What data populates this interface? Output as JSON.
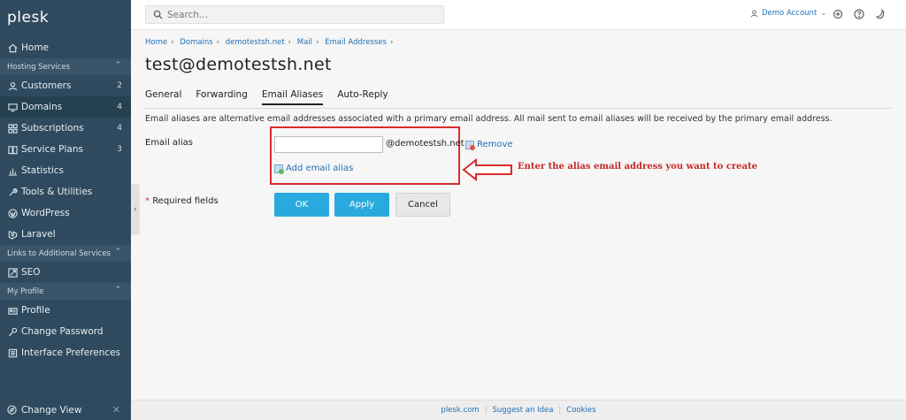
{
  "sidebar": {
    "logo": "plesk",
    "home": "Home",
    "sections": {
      "hosting": "Hosting Services",
      "links": "Links to Additional Services",
      "profile": "My Profile"
    },
    "hosting_items": [
      {
        "label": "Customers",
        "count": "2"
      },
      {
        "label": "Domains",
        "count": "4"
      },
      {
        "label": "Subscriptions",
        "count": "4"
      },
      {
        "label": "Service Plans",
        "count": "3"
      },
      {
        "label": "Statistics",
        "count": ""
      },
      {
        "label": "Tools & Utilities",
        "count": ""
      },
      {
        "label": "WordPress",
        "count": ""
      },
      {
        "label": "Laravel",
        "count": ""
      }
    ],
    "links_items": [
      {
        "label": "SEO"
      }
    ],
    "profile_items": [
      {
        "label": "Profile"
      },
      {
        "label": "Change Password"
      },
      {
        "label": "Interface Preferences"
      }
    ],
    "change_view": "Change View"
  },
  "topbar": {
    "search_placeholder": "Search...",
    "account": "Demo Account"
  },
  "breadcrumb": [
    "Home",
    "Domains",
    "demotestsh.net",
    "Mail",
    "Email Addresses"
  ],
  "page_title": "test@demotestsh.net",
  "tabs": [
    "General",
    "Forwarding",
    "Email Aliases",
    "Auto-Reply"
  ],
  "description": "Email aliases are alternative email addresses associated with a primary email address. All mail sent to email aliases will be received by the primary email address.",
  "form": {
    "field_label": "Email alias",
    "alias_value": "",
    "domain_suffix": "@demotestsh.net",
    "remove_label": "Remove",
    "add_label": "Add email alias",
    "required_text": "Required fields",
    "ok_label": "OK",
    "apply_label": "Apply",
    "cancel_label": "Cancel"
  },
  "annotation": "Enter the alias email address you want to create",
  "footer": [
    "plesk.com",
    "Suggest an Idea",
    "Cookies"
  ],
  "colors": {
    "sidebar_bg": "#2f4a5e",
    "accent": "#28aade",
    "link": "#1f6fb5",
    "highlight_red": "#d92b2b"
  }
}
